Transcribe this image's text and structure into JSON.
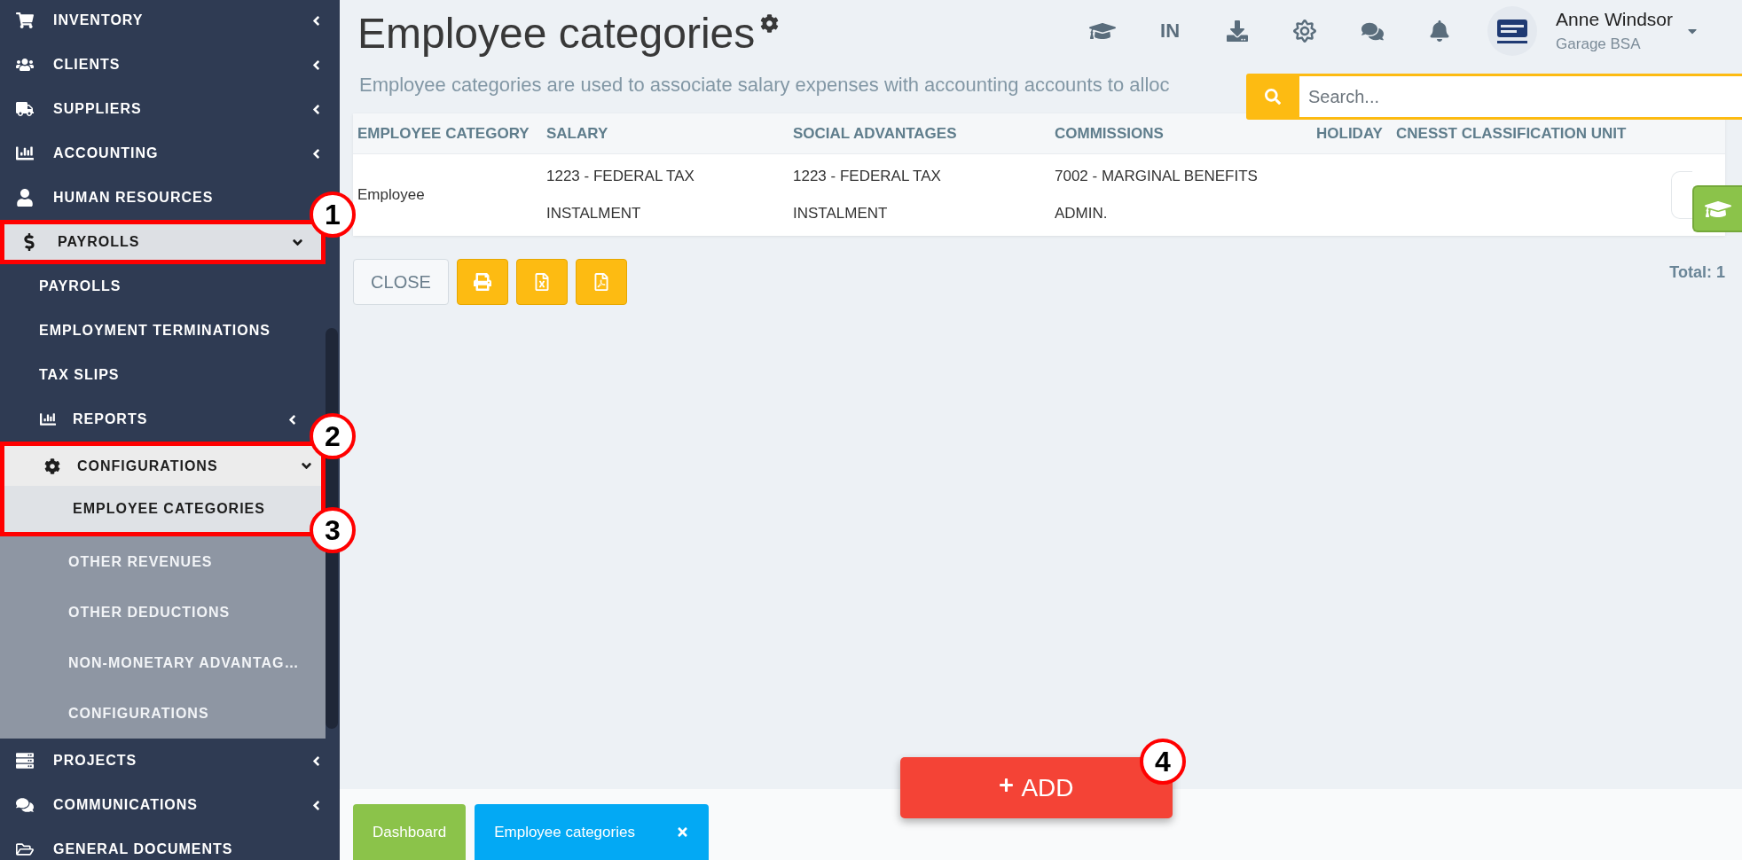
{
  "sidebar": {
    "items": [
      {
        "label": "INVENTORY",
        "selected": false,
        "expanded": false
      },
      {
        "label": "CLIENTS",
        "selected": false,
        "expanded": false
      },
      {
        "label": "SUPPLIERS",
        "selected": false,
        "expanded": false
      },
      {
        "label": "ACCOUNTING",
        "selected": false,
        "expanded": false
      },
      {
        "label": "HUMAN RESOURCES",
        "selected": false
      },
      {
        "label": "PAYROLLS",
        "selected": true,
        "expanded": true,
        "highlighted": true,
        "callout": "1",
        "children": [
          {
            "label": "PAYROLLS",
            "selected": false
          },
          {
            "label": "EMPLOYMENT TERMINATIONS",
            "selected": false
          },
          {
            "label": "TAX SLIPS",
            "selected": false
          },
          {
            "label": "REPORTS",
            "selected": false,
            "expanded": false
          },
          {
            "label": "CONFIGURATIONS",
            "selected": true,
            "expanded": true,
            "highlighted": true,
            "callout": "2",
            "children": [
              {
                "label": "EMPLOYEE CATEGORIES",
                "selected": true,
                "highlighted": true,
                "callout": "3"
              },
              {
                "label": "OTHER REVENUES",
                "selected": false
              },
              {
                "label": "OTHER DEDUCTIONS",
                "selected": false
              },
              {
                "label": "NON-MONETARY ADVANTAG…",
                "selected": false
              },
              {
                "label": "CONFIGURATIONS",
                "selected": false
              }
            ]
          }
        ]
      },
      {
        "label": "PROJECTS",
        "selected": false,
        "expanded": false
      },
      {
        "label": "COMMUNICATIONS",
        "selected": false,
        "expanded": false
      },
      {
        "label": "GENERAL DOCUMENTS",
        "selected": false
      }
    ]
  },
  "header": {
    "title": "Employee categories",
    "subtitle": "Employee categories are used to associate salary expenses with accounting accounts to alloc",
    "language": "IN"
  },
  "user": {
    "name": "Anne Windsor",
    "company": "Garage BSA"
  },
  "search": {
    "placeholder": "Search..."
  },
  "table": {
    "columns": [
      "EMPLOYEE CATEGORY",
      "SALARY",
      "SOCIAL ADVANTAGES",
      "COMMISSIONS",
      "HOLIDAY",
      "CNESST CLASSIFICATION UNIT"
    ],
    "rows": [
      {
        "cells": [
          "Employee",
          "1223 - FEDERAL TAX INSTALMENT",
          "1223 - FEDERAL TAX INSTALMENT",
          "7002 - MARGINAL BENEFITS ADMIN."
        ]
      }
    ]
  },
  "actions": {
    "close": "CLOSE",
    "total": "Total: 1"
  },
  "add_button": {
    "label": "ADD",
    "callout": "4"
  },
  "bottom_tabs": [
    {
      "label": "Dashboard",
      "color": "#8bc34a",
      "closable": false
    },
    {
      "label": "Employee categories",
      "color": "#03a9f4",
      "closable": true
    }
  ]
}
